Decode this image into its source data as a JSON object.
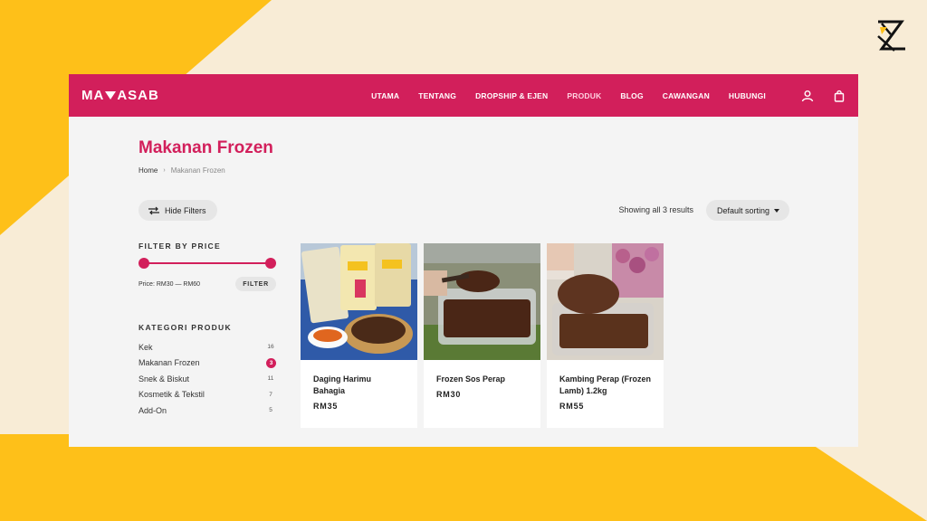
{
  "brand": {
    "logo_left": "MA",
    "logo_right": "ASAB"
  },
  "nav": {
    "items": [
      {
        "label": "UTAMA"
      },
      {
        "label": "TENTANG"
      },
      {
        "label": "DROPSHIP & EJEN"
      },
      {
        "label": "PRODUK",
        "active": true
      },
      {
        "label": "BLOG"
      },
      {
        "label": "CAWANGAN"
      },
      {
        "label": "HUBUNGI"
      }
    ],
    "icons": [
      "user-icon",
      "shopping-bag-icon"
    ]
  },
  "page": {
    "title": "Makanan Frozen",
    "breadcrumb": {
      "home": "Home",
      "separator": "›",
      "current": "Makanan Frozen"
    }
  },
  "toolbar": {
    "hide_filters": "Hide Filters",
    "results": "Showing all 3 results",
    "sorting": "Default sorting"
  },
  "filter_price": {
    "heading": "FILTER BY PRICE",
    "price_label": "Price: RM30 — RM60",
    "button": "FILTER",
    "range_min": 30,
    "range_max": 60
  },
  "categories": {
    "heading": "KATEGORI PRODUK",
    "items": [
      {
        "label": "Kek",
        "count": "16"
      },
      {
        "label": "Makanan Frozen",
        "count": "3",
        "active": true
      },
      {
        "label": "Snek & Biskut",
        "count": "11"
      },
      {
        "label": "Kosmetik & Tekstil",
        "count": "7"
      },
      {
        "label": "Add-On",
        "count": "5"
      }
    ]
  },
  "products": [
    {
      "name": "Daging Harimu Bahagia",
      "price": "RM35"
    },
    {
      "name": "Frozen Sos Perap",
      "price": "RM30"
    },
    {
      "name": "Kambing Perap (Frozen Lamb) 1.2kg",
      "price": "RM55"
    }
  ],
  "colors": {
    "brand": "#d21f5b",
    "background_cream": "#f8ecd6",
    "background_yellow": "#fec019",
    "panel": "#f4f4f4"
  }
}
